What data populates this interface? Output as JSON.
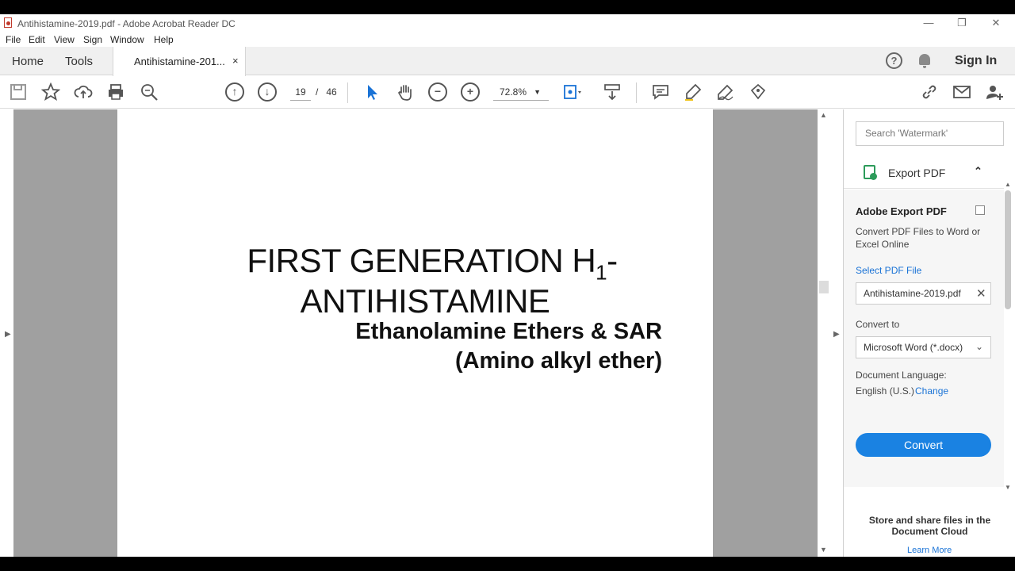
{
  "window": {
    "title": "Antihistamine-2019.pdf - Adobe Acrobat Reader DC",
    "minimize": "—",
    "restore": "❐",
    "close": "✕"
  },
  "menu": [
    "File",
    "Edit",
    "View",
    "Sign",
    "Window",
    "Help"
  ],
  "tabs": {
    "home": "Home",
    "tools": "Tools",
    "document": "Antihistamine-201...",
    "close": "×",
    "help_glyph": "?",
    "sign_in": "Sign In"
  },
  "toolbar": {
    "current_page": "19",
    "page_sep": "/",
    "total_pages": "46",
    "zoom": "72.8%",
    "icons": [
      "save-icon",
      "bookmark-star-icon",
      "upload-cloud-icon",
      "print-icon",
      "search-zoom-icon",
      "previous-page-icon",
      "next-page-icon",
      "select-arrow-icon",
      "hand-tool-icon",
      "zoom-out-icon",
      "zoom-in-icon",
      "fit-page-icon",
      "scroll-mode-icon",
      "comment-icon",
      "highlight-icon",
      "sign-icon",
      "stamp-icon",
      "share-link-icon",
      "email-icon",
      "add-user-icon"
    ]
  },
  "document": {
    "heading_line1": "FIRST GENERATION H",
    "heading_subscript": "1",
    "heading_line1_end": "-",
    "heading_line2": "ANTIHISTAMINE",
    "subheading_line1": "Ethanolamine Ethers & SAR",
    "subheading_line2": "(Amino alkyl ether)"
  },
  "right_panel": {
    "search_placeholder": "Search 'Watermark'",
    "export_title": "Export PDF",
    "adobe_export_title": "Adobe Export PDF",
    "adobe_export_desc": "Convert PDF Files to Word or Excel Online",
    "select_file_label": "Select PDF File",
    "selected_file": "Antihistamine-2019.pdf",
    "convert_to_label": "Convert to",
    "convert_to_value": "Microsoft Word (*.docx)",
    "doc_language_label": "Document Language:",
    "doc_language_value": "English (U.S.)",
    "change_link": "Change",
    "convert_button": "Convert",
    "store_text": "Store and share files in the Document Cloud",
    "learn_more": "Learn More"
  },
  "colors": {
    "accent": "#1a82e2",
    "link": "#1a73d6",
    "doc_background": "#a0a0a0"
  }
}
